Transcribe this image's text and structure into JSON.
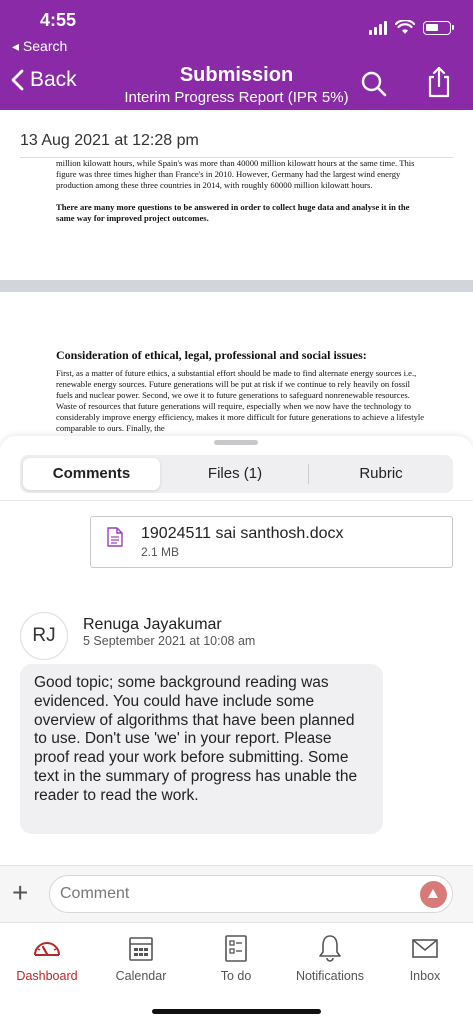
{
  "status_bar": {
    "time": "4:55",
    "back_app": "◂ Search"
  },
  "header": {
    "back_label": "Back",
    "title": "Submission",
    "subtitle": "Interim Progress Report (IPR 5%)",
    "search_icon": "search-icon",
    "share_icon": "share-icon",
    "color": "#8a2aa7"
  },
  "document": {
    "date": "13 Aug 2021 at 12:28 pm",
    "para1": "million kilowatt hours, while Spain's was more than 40000 million kilowatt hours at the same time. This figure was three times higher than France's in 2010. However, Germany had the largest wind energy production among these three countries in 2014, with roughly 60000 million kilowatt hours.",
    "para2": "There are many more questions to be answered in order to collect huge data and analyse it in the same way for improved project outcomes.",
    "heading": "Consideration of ethical, legal, professional and social issues:",
    "para3": "First, as a matter of future ethics, a substantial effort should be made to find alternate energy sources i.e., renewable energy sources. Future generations will be put at risk if we continue to rely heavily on fossil fuels and nuclear power. Second, we owe it to future generations to safeguard nonrenewable resources. Waste of resources that future generations will require, especially when we now have the technology to considerably improve energy efficiency, makes it more difficult for future generations to achieve a lifestyle comparable to ours. Finally, the"
  },
  "tabs": [
    {
      "label": "Comments",
      "active": true
    },
    {
      "label": "Files (1)",
      "active": false
    },
    {
      "label": "Rubric",
      "active": false
    }
  ],
  "attachment": {
    "name": "19024511 sai santhosh.docx",
    "size": "2.1 MB",
    "icon": "document-icon"
  },
  "comment": {
    "initials": "RJ",
    "author": "Renuga Jayakumar",
    "timestamp": "5 September 2021 at 10:08 am",
    "body": "Good topic; some background reading was evidenced.  You could have include some overview of algorithms that have been planned to use.  Don't use 'we' in your report.  Please proof read your work before submitting.  Some text in the summary of progress has unable the reader to read the work."
  },
  "composer": {
    "placeholder": "Comment",
    "add_icon": "plus-icon",
    "send_icon": "send-icon",
    "send_color": "#d87b78"
  },
  "nav": [
    {
      "label": "Dashboard",
      "icon": "dashboard-icon",
      "active": true
    },
    {
      "label": "Calendar",
      "icon": "calendar-icon",
      "active": false
    },
    {
      "label": "To do",
      "icon": "todo-icon",
      "active": false
    },
    {
      "label": "Notifications",
      "icon": "bell-icon",
      "active": false
    },
    {
      "label": "Inbox",
      "icon": "inbox-icon",
      "active": false
    }
  ],
  "accent_color": "#b8282a"
}
